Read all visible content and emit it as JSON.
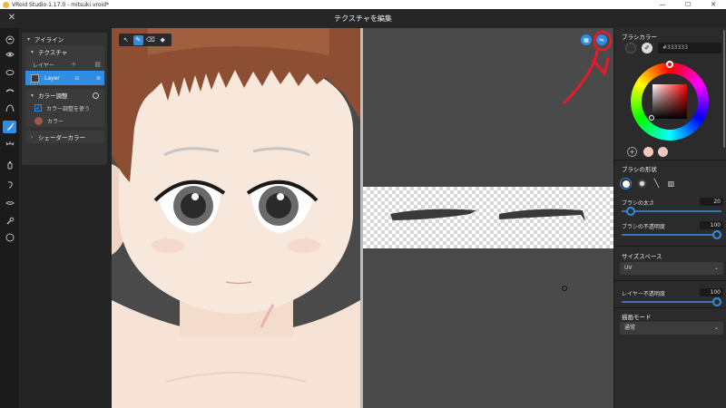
{
  "window": {
    "title": "VRoid Studio 1.17.0 - mitsuki.vroid*",
    "minimize": "—",
    "maximize": "☐",
    "close": "✕"
  },
  "header": {
    "title": "テクスチャを編集",
    "close_glyph": "✕"
  },
  "tool_rail": {
    "icons": [
      "head-icon",
      "eye-icon",
      "mouth-icon",
      "eyebrow-icon",
      "hair-icon",
      "brush-icon",
      "eyelash-icon",
      "bottle-icon",
      "ear-icon",
      "lips-icon",
      "wrench-icon",
      "face-outline-icon"
    ],
    "active_index": 5
  },
  "layers": {
    "group_title": "アイライン",
    "texture_title": "テクスチャ",
    "layer_label": "レイヤー",
    "layer_name": "Layer",
    "color_adjust_title": "カラー調整",
    "use_color_adjust": "カラー調整を使う",
    "color_label": "カラー",
    "color_swatch": "#a0574a",
    "shader_color": "シェーダーカラー"
  },
  "viewport": {
    "tools": [
      "select-tool",
      "pen-tool",
      "eraser-tool",
      "fill-tool"
    ],
    "active_tool_index": 1
  },
  "uv": {
    "buttons": [
      "grid-icon",
      "mirror-icon"
    ]
  },
  "right": {
    "brush_color_title": "ブラシカラー",
    "hex_value": "#333333",
    "preset_colors": [
      "#f3c7bc",
      "#efc6bd"
    ],
    "brush_shape_title": "ブラシの形状",
    "brush_size_label": "ブラシの太さ",
    "brush_size_value": "20",
    "brush_size_fraction": 0.05,
    "brush_opacity_label": "ブラシの不透明度",
    "brush_opacity_value": "100",
    "brush_opacity_fraction": 1.0,
    "size_space_title": "サイズスペース",
    "size_space_value": "UV",
    "layer_opacity_label": "レイヤー不透明度",
    "layer_opacity_value": "100",
    "layer_opacity_fraction": 1.0,
    "blend_mode_title": "描画モード",
    "blend_mode_value": "通常",
    "dropdown_arrow": "⌄"
  },
  "colors": {
    "accent": "#2f8de4",
    "annotation_red": "#e8192c",
    "skin": "#f6e3d6",
    "hair": "#8d4f33"
  }
}
